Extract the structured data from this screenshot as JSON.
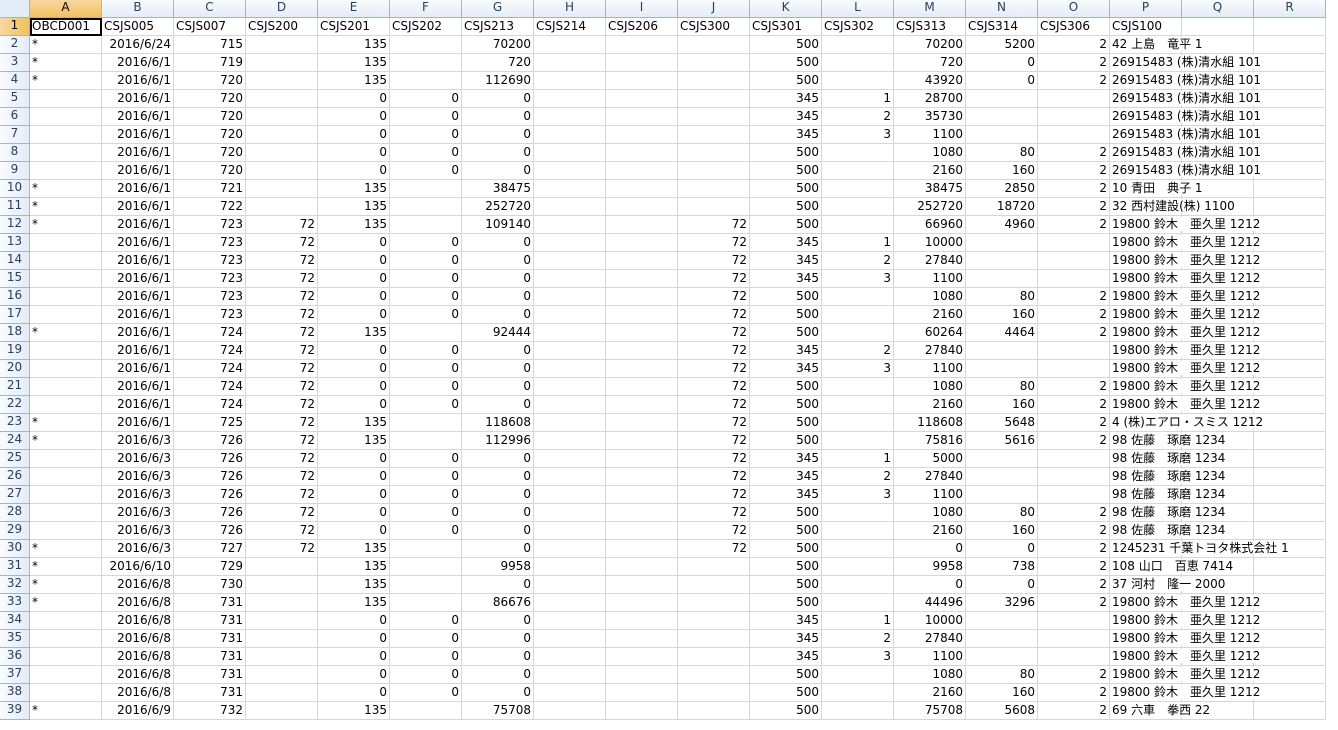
{
  "sheet": {
    "columns": [
      "A",
      "B",
      "C",
      "D",
      "E",
      "F",
      "G",
      "H",
      "I",
      "J",
      "K",
      "L",
      "M",
      "N",
      "O",
      "P",
      "Q",
      "R"
    ],
    "active_cell": "A1",
    "rows": [
      [
        "OBCD001",
        "CSJS005",
        "CSJS007",
        "CSJS200",
        "CSJS201",
        "CSJS202",
        "CSJS213",
        "CSJS214",
        "CSJS206",
        "CSJS300",
        "CSJS301",
        "CSJS302",
        "CSJS313",
        "CSJS314",
        "CSJS306",
        "CSJS100",
        "",
        ""
      ],
      [
        "*",
        "2016/6/24",
        "715",
        "",
        "135",
        "",
        "70200",
        "",
        "",
        "",
        "500",
        "",
        "70200",
        "5200",
        "2",
        "42 上島　竜平 1",
        "",
        ""
      ],
      [
        "*",
        "2016/6/1",
        "719",
        "",
        "135",
        "",
        "720",
        "",
        "",
        "",
        "500",
        "",
        "720",
        "0",
        "2",
        "26915483 (株)清水組 101",
        "",
        ""
      ],
      [
        "*",
        "2016/6/1",
        "720",
        "",
        "135",
        "",
        "112690",
        "",
        "",
        "",
        "500",
        "",
        "43920",
        "0",
        "2",
        "26915483 (株)清水組 101",
        "",
        ""
      ],
      [
        "",
        "2016/6/1",
        "720",
        "",
        "0",
        "0",
        "0",
        "",
        "",
        "",
        "345",
        "1",
        "28700",
        "",
        "",
        "26915483 (株)清水組 101",
        "",
        ""
      ],
      [
        "",
        "2016/6/1",
        "720",
        "",
        "0",
        "0",
        "0",
        "",
        "",
        "",
        "345",
        "2",
        "35730",
        "",
        "",
        "26915483 (株)清水組 101",
        "",
        ""
      ],
      [
        "",
        "2016/6/1",
        "720",
        "",
        "0",
        "0",
        "0",
        "",
        "",
        "",
        "345",
        "3",
        "1100",
        "",
        "",
        "26915483 (株)清水組 101",
        "",
        ""
      ],
      [
        "",
        "2016/6/1",
        "720",
        "",
        "0",
        "0",
        "0",
        "",
        "",
        "",
        "500",
        "",
        "1080",
        "80",
        "2",
        "26915483 (株)清水組 101",
        "",
        ""
      ],
      [
        "",
        "2016/6/1",
        "720",
        "",
        "0",
        "0",
        "0",
        "",
        "",
        "",
        "500",
        "",
        "2160",
        "160",
        "2",
        "26915483 (株)清水組 101",
        "",
        ""
      ],
      [
        "*",
        "2016/6/1",
        "721",
        "",
        "135",
        "",
        "38475",
        "",
        "",
        "",
        "500",
        "",
        "38475",
        "2850",
        "2",
        "10 青田　典子 1",
        "",
        ""
      ],
      [
        "*",
        "2016/6/1",
        "722",
        "",
        "135",
        "",
        "252720",
        "",
        "",
        "",
        "500",
        "",
        "252720",
        "18720",
        "2",
        "32 西村建設(株) 1100",
        "",
        ""
      ],
      [
        "*",
        "2016/6/1",
        "723",
        "72",
        "135",
        "",
        "109140",
        "",
        "",
        "72",
        "500",
        "",
        "66960",
        "4960",
        "2",
        "19800 鈴木　亜久里 1212",
        "",
        ""
      ],
      [
        "",
        "2016/6/1",
        "723",
        "72",
        "0",
        "0",
        "0",
        "",
        "",
        "72",
        "345",
        "1",
        "10000",
        "",
        "",
        "19800 鈴木　亜久里 1212",
        "",
        ""
      ],
      [
        "",
        "2016/6/1",
        "723",
        "72",
        "0",
        "0",
        "0",
        "",
        "",
        "72",
        "345",
        "2",
        "27840",
        "",
        "",
        "19800 鈴木　亜久里 1212",
        "",
        ""
      ],
      [
        "",
        "2016/6/1",
        "723",
        "72",
        "0",
        "0",
        "0",
        "",
        "",
        "72",
        "345",
        "3",
        "1100",
        "",
        "",
        "19800 鈴木　亜久里 1212",
        "",
        ""
      ],
      [
        "",
        "2016/6/1",
        "723",
        "72",
        "0",
        "0",
        "0",
        "",
        "",
        "72",
        "500",
        "",
        "1080",
        "80",
        "2",
        "19800 鈴木　亜久里 1212",
        "",
        ""
      ],
      [
        "",
        "2016/6/1",
        "723",
        "72",
        "0",
        "0",
        "0",
        "",
        "",
        "72",
        "500",
        "",
        "2160",
        "160",
        "2",
        "19800 鈴木　亜久里 1212",
        "",
        ""
      ],
      [
        "*",
        "2016/6/1",
        "724",
        "72",
        "135",
        "",
        "92444",
        "",
        "",
        "72",
        "500",
        "",
        "60264",
        "4464",
        "2",
        "19800 鈴木　亜久里 1212",
        "",
        ""
      ],
      [
        "",
        "2016/6/1",
        "724",
        "72",
        "0",
        "0",
        "0",
        "",
        "",
        "72",
        "345",
        "2",
        "27840",
        "",
        "",
        "19800 鈴木　亜久里 1212",
        "",
        ""
      ],
      [
        "",
        "2016/6/1",
        "724",
        "72",
        "0",
        "0",
        "0",
        "",
        "",
        "72",
        "345",
        "3",
        "1100",
        "",
        "",
        "19800 鈴木　亜久里 1212",
        "",
        ""
      ],
      [
        "",
        "2016/6/1",
        "724",
        "72",
        "0",
        "0",
        "0",
        "",
        "",
        "72",
        "500",
        "",
        "1080",
        "80",
        "2",
        "19800 鈴木　亜久里 1212",
        "",
        ""
      ],
      [
        "",
        "2016/6/1",
        "724",
        "72",
        "0",
        "0",
        "0",
        "",
        "",
        "72",
        "500",
        "",
        "2160",
        "160",
        "2",
        "19800 鈴木　亜久里 1212",
        "",
        ""
      ],
      [
        "*",
        "2016/6/1",
        "725",
        "72",
        "135",
        "",
        "118608",
        "",
        "",
        "72",
        "500",
        "",
        "118608",
        "5648",
        "2",
        "4 (株)エアロ・スミス 1212",
        "",
        ""
      ],
      [
        "*",
        "2016/6/3",
        "726",
        "72",
        "135",
        "",
        "112996",
        "",
        "",
        "72",
        "500",
        "",
        "75816",
        "5616",
        "2",
        "98 佐藤　琢磨 1234",
        "",
        ""
      ],
      [
        "",
        "2016/6/3",
        "726",
        "72",
        "0",
        "0",
        "0",
        "",
        "",
        "72",
        "345",
        "1",
        "5000",
        "",
        "",
        "98 佐藤　琢磨 1234",
        "",
        ""
      ],
      [
        "",
        "2016/6/3",
        "726",
        "72",
        "0",
        "0",
        "0",
        "",
        "",
        "72",
        "345",
        "2",
        "27840",
        "",
        "",
        "98 佐藤　琢磨 1234",
        "",
        ""
      ],
      [
        "",
        "2016/6/3",
        "726",
        "72",
        "0",
        "0",
        "0",
        "",
        "",
        "72",
        "345",
        "3",
        "1100",
        "",
        "",
        "98 佐藤　琢磨 1234",
        "",
        ""
      ],
      [
        "",
        "2016/6/3",
        "726",
        "72",
        "0",
        "0",
        "0",
        "",
        "",
        "72",
        "500",
        "",
        "1080",
        "80",
        "2",
        "98 佐藤　琢磨 1234",
        "",
        ""
      ],
      [
        "",
        "2016/6/3",
        "726",
        "72",
        "0",
        "0",
        "0",
        "",
        "",
        "72",
        "500",
        "",
        "2160",
        "160",
        "2",
        "98 佐藤　琢磨 1234",
        "",
        ""
      ],
      [
        "*",
        "2016/6/3",
        "727",
        "72",
        "135",
        "",
        "0",
        "",
        "",
        "72",
        "500",
        "",
        "0",
        "0",
        "2",
        "1245231 千葉トヨタ株式会社 1",
        "",
        ""
      ],
      [
        "*",
        "2016/6/10",
        "729",
        "",
        "135",
        "",
        "9958",
        "",
        "",
        "",
        "500",
        "",
        "9958",
        "738",
        "2",
        "108 山口　百恵 7414",
        "",
        ""
      ],
      [
        "*",
        "2016/6/8",
        "730",
        "",
        "135",
        "",
        "0",
        "",
        "",
        "",
        "500",
        "",
        "0",
        "0",
        "2",
        "37 河村　隆一 2000",
        "",
        ""
      ],
      [
        "*",
        "2016/6/8",
        "731",
        "",
        "135",
        "",
        "86676",
        "",
        "",
        "",
        "500",
        "",
        "44496",
        "3296",
        "2",
        "19800 鈴木　亜久里 1212",
        "",
        ""
      ],
      [
        "",
        "2016/6/8",
        "731",
        "",
        "0",
        "0",
        "0",
        "",
        "",
        "",
        "345",
        "1",
        "10000",
        "",
        "",
        "19800 鈴木　亜久里 1212",
        "",
        ""
      ],
      [
        "",
        "2016/6/8",
        "731",
        "",
        "0",
        "0",
        "0",
        "",
        "",
        "",
        "345",
        "2",
        "27840",
        "",
        "",
        "19800 鈴木　亜久里 1212",
        "",
        ""
      ],
      [
        "",
        "2016/6/8",
        "731",
        "",
        "0",
        "0",
        "0",
        "",
        "",
        "",
        "345",
        "3",
        "1100",
        "",
        "",
        "19800 鈴木　亜久里 1212",
        "",
        ""
      ],
      [
        "",
        "2016/6/8",
        "731",
        "",
        "0",
        "0",
        "0",
        "",
        "",
        "",
        "500",
        "",
        "1080",
        "80",
        "2",
        "19800 鈴木　亜久里 1212",
        "",
        ""
      ],
      [
        "",
        "2016/6/8",
        "731",
        "",
        "0",
        "0",
        "0",
        "",
        "",
        "",
        "500",
        "",
        "2160",
        "160",
        "2",
        "19800 鈴木　亜久里 1212",
        "",
        ""
      ],
      [
        "*",
        "2016/6/9",
        "732",
        "",
        "135",
        "",
        "75708",
        "",
        "",
        "",
        "500",
        "",
        "75708",
        "5608",
        "2",
        "69 六車　拳西 22",
        "",
        ""
      ]
    ]
  }
}
